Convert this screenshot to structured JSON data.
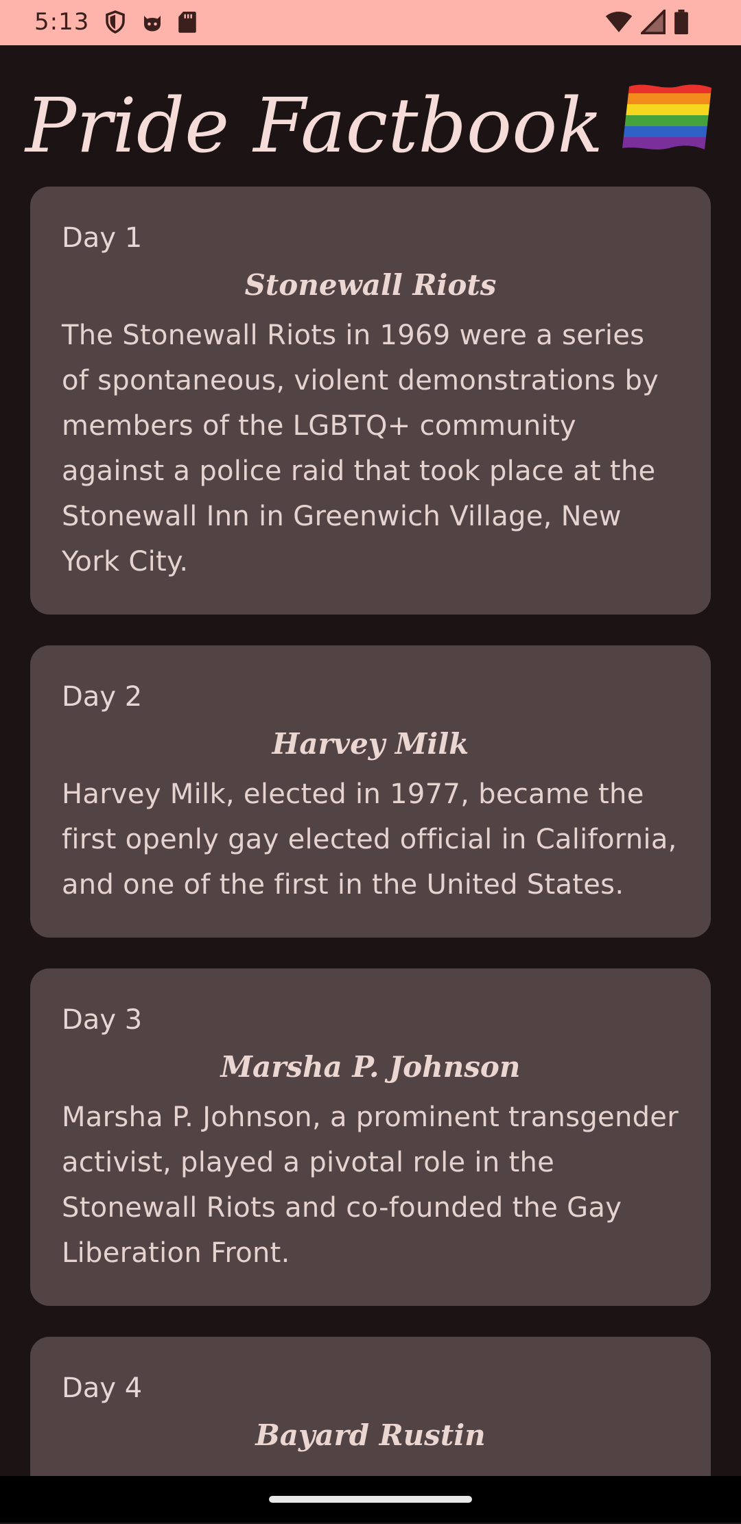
{
  "status_bar": {
    "time": "5:13",
    "left_icons": [
      "shield-icon",
      "cat-face-icon",
      "sd-card-icon"
    ],
    "right_icons": [
      "wifi-icon",
      "cellular-signal-icon",
      "battery-icon"
    ],
    "background_color": "#ffb4ab"
  },
  "app": {
    "title": "Pride Factbook",
    "title_emoji": "rainbow-flag-icon"
  },
  "facts": [
    {
      "day": "Day 1",
      "title": "Stonewall Riots",
      "body": "The Stonewall Riots in 1969 were a series of spontaneous, violent demonstrations by members of the LGBTQ+ community against a police raid that took place at the Stonewall Inn in Greenwich Village, New York City."
    },
    {
      "day": "Day 2",
      "title": "Harvey Milk",
      "body": "Harvey Milk, elected in 1977, became the first openly gay elected official in California, and one of the first in the United States."
    },
    {
      "day": "Day 3",
      "title": "Marsha P. Johnson",
      "body": "Marsha P. Johnson, a prominent transgender activist, played a pivotal role in the Stonewall Riots and co-founded the Gay Liberation Front."
    },
    {
      "day": "Day 4",
      "title": "Bayard Rustin",
      "body": ""
    }
  ],
  "colors": {
    "background": "#1b1314",
    "card": "#524444",
    "text": "#e9d6d3",
    "title": "#f6dcd8"
  }
}
